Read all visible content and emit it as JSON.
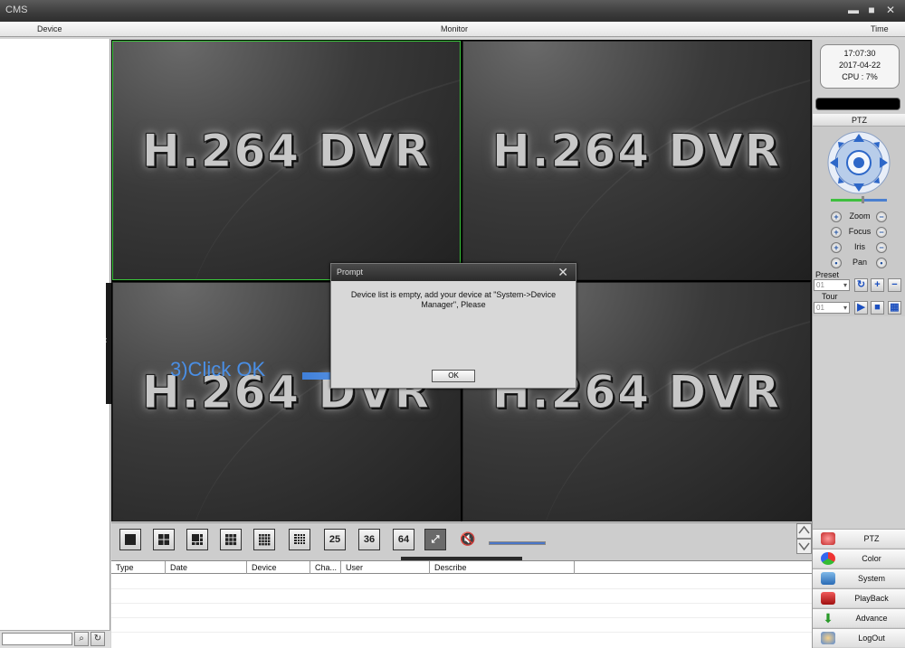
{
  "window": {
    "title": "CMS",
    "min": "▬",
    "max": "■",
    "close": "✕"
  },
  "tabs": {
    "device": "Device",
    "monitor": "Monitor",
    "time": "Time"
  },
  "video": {
    "tiles": [
      "H.264 DVR",
      "H.264 DVR",
      "H.264 DVR",
      "H.264 DVR"
    ]
  },
  "annotation": {
    "text": "3)Click OK"
  },
  "dialog": {
    "title": "Prompt",
    "message_line1": "Device list is empty, add your device at \"System->Device",
    "message_line2": "Manager\", Please",
    "ok_label": "OK"
  },
  "status": {
    "time": "17:07:30",
    "date": "2017-04-22",
    "cpu": "CPU : 7%"
  },
  "ptz": {
    "header": "PTZ",
    "speed": 0.55,
    "controls": [
      "Zoom",
      "Focus",
      "Iris",
      "Pan"
    ],
    "preset_label": "Preset",
    "preset_value": "01",
    "tour_label": "Tour",
    "tour_value": "01"
  },
  "menu": [
    "PTZ",
    "Color",
    "System",
    "PlayBack",
    "Advance",
    "LogOut"
  ],
  "toolbar": {
    "split25": "25",
    "split36": "36",
    "split64": "64",
    "volume": 1.0
  },
  "log": {
    "columns": [
      "Type",
      "Date",
      "Device",
      "Cha...",
      "User",
      "Describe"
    ]
  },
  "colors": {
    "active_border": "#39c43a",
    "annotation": "#4a8fe6"
  }
}
